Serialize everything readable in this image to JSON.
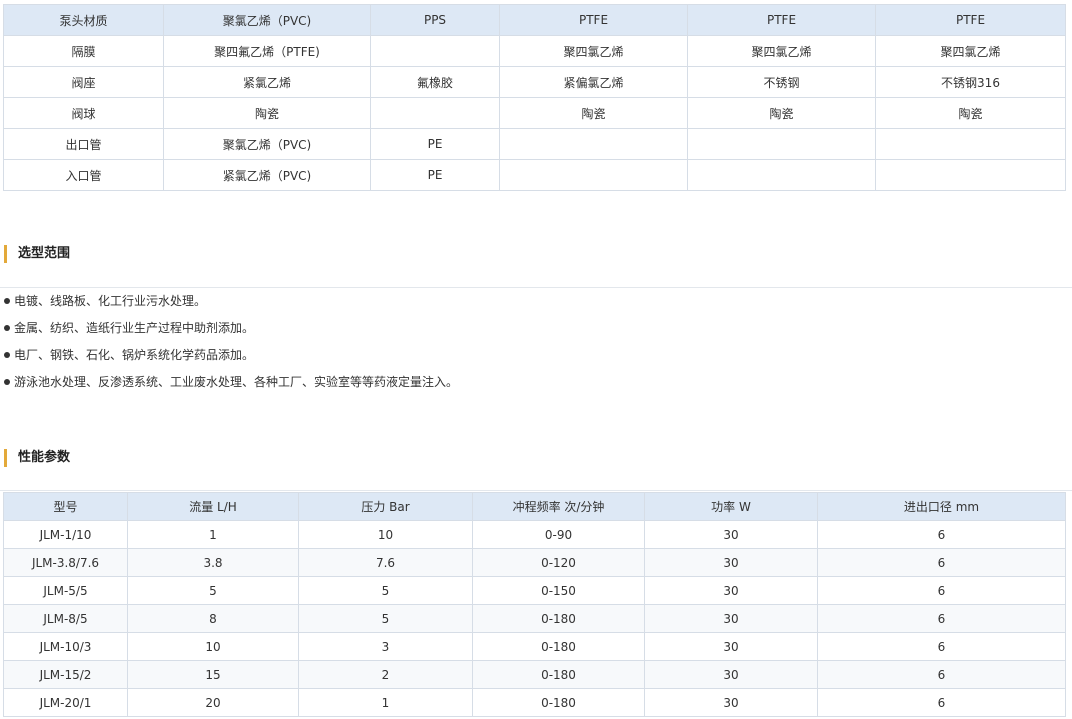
{
  "materials_table": {
    "header": [
      "泵头材质",
      "聚氯乙烯（PVC)",
      "PPS",
      "PTFE",
      "PTFE",
      "PTFE"
    ],
    "rows": [
      [
        "隔膜",
        "聚四氟乙烯（PTFE)",
        "",
        "聚四氯乙烯",
        "聚四氯乙烯",
        "聚四氯乙烯"
      ],
      [
        "阀座",
        "紧氯乙烯",
        "氟橡胶",
        "紧偏氯乙烯",
        "不锈钢",
        "不锈钢316"
      ],
      [
        "阀球",
        "陶瓷",
        "",
        "陶瓷",
        "陶瓷",
        "陶瓷"
      ],
      [
        "出口管",
        "聚氯乙烯（PVC)",
        "PE",
        "",
        "",
        ""
      ],
      [
        "入口管",
        "紧氯乙烯（PVC)",
        "PE",
        "",
        "",
        ""
      ]
    ]
  },
  "selection_range": {
    "title": "选型范围",
    "items": [
      "电镀、线路板、化工行业污水处理。",
      "金属、纺织、造纸行业生产过程中助剂添加。",
      "电厂、钢铁、石化、锅炉系统化学药品添加。",
      "游泳池水处理、反渗透系统、工业废水处理、各种工厂、实验室等等药液定量注入。"
    ]
  },
  "performance": {
    "title": "性能参数",
    "header": [
      "型号",
      "流量 L/H",
      "压力 Bar",
      "冲程频率 次/分钟",
      "功率 W",
      "进出口径 mm"
    ],
    "rows": [
      [
        "JLM-1/10",
        "1",
        "10",
        "0-90",
        "30",
        "6"
      ],
      [
        "JLM-3.8/7.6",
        "3.8",
        "7.6",
        "0-120",
        "30",
        "6"
      ],
      [
        "JLM-5/5",
        "5",
        "5",
        "0-150",
        "30",
        "6"
      ],
      [
        "JLM-8/5",
        "8",
        "5",
        "0-180",
        "30",
        "6"
      ],
      [
        "JLM-10/3",
        "10",
        "3",
        "0-180",
        "30",
        "6"
      ],
      [
        "JLM-15/2",
        "15",
        "2",
        "0-180",
        "30",
        "6"
      ],
      [
        "JLM-20/1",
        "20",
        "1",
        "0-180",
        "30",
        "6"
      ]
    ]
  },
  "colors": {
    "header_bg": "#dde8f5",
    "border": "#d6dde6",
    "accent_bar": "#e3a93a"
  }
}
